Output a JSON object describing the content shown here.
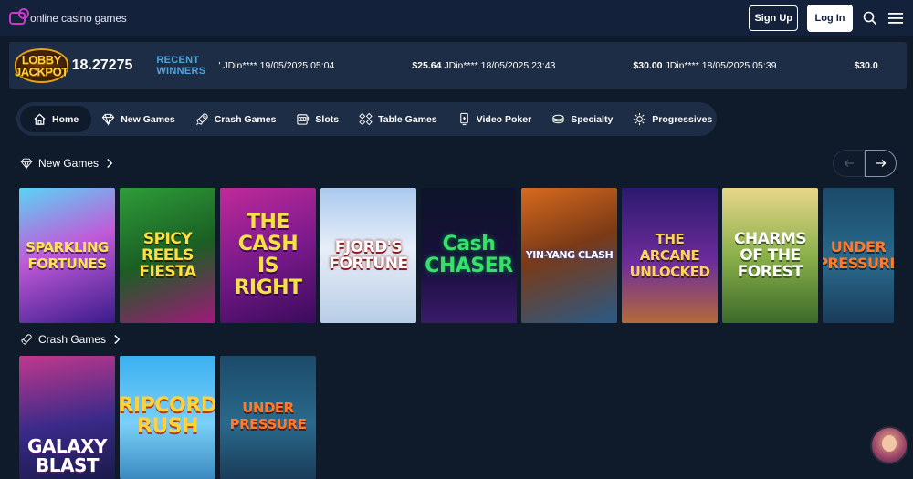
{
  "header": {
    "logo_text": "online casino games",
    "signup_label": "Sign Up",
    "login_label": "Log In"
  },
  "jackpot": {
    "badge_line1": "LOBBY",
    "badge_line2": "JACKPOT",
    "amount": "18.27275",
    "recent_winners_label": "RECENT WINNERS",
    "winners": [
      {
        "amount": "",
        "text": "' JDin**** 19/05/2025 05:04"
      },
      {
        "amount": "$25.64",
        "text": " JDin**** 18/05/2025 23:43"
      },
      {
        "amount": "$30.00",
        "text": " JDin**** 18/05/2025 05:39"
      },
      {
        "amount": "$30.0",
        "text": ""
      }
    ]
  },
  "categories": [
    {
      "label": "Home",
      "icon": "home-icon",
      "active": true
    },
    {
      "label": "New Games",
      "icon": "diamond-icon"
    },
    {
      "label": "Crash Games",
      "icon": "rocket-icon"
    },
    {
      "label": "Slots",
      "icon": "slot-machine-icon"
    },
    {
      "label": "Table Games",
      "icon": "cards-icon"
    },
    {
      "label": "Video Poker",
      "icon": "poker-icon"
    },
    {
      "label": "Specialty",
      "icon": "chips-icon"
    },
    {
      "label": "Progressives",
      "icon": "sparkle-icon"
    }
  ],
  "new_games": {
    "title": "New Games",
    "games": [
      "SPARKLING\nFORTUNES",
      "SPICY\nREELS\nFIESTA",
      "THE\nCASH\nIS\nRIGHT",
      "FJORD'S\nFORTUNE",
      "Cash\nCHASER",
      "YIN-YANG CLASH",
      "THE ARCANE\nUNLOCKED",
      "CHARMS\nOF THE\nFOREST",
      "UNDER\nPRESSURE"
    ]
  },
  "crash_games": {
    "title": "Crash Games",
    "games": [
      "GALAXY\nBLAST",
      "RIPCORD\nRUSH",
      "UNDER\nPRESSURE"
    ]
  },
  "colors": {
    "background": "#0f1a2b",
    "panel": "#1d2d45",
    "accent_blue": "#4ea4e0",
    "logo_magenta": "#c63ac8"
  }
}
